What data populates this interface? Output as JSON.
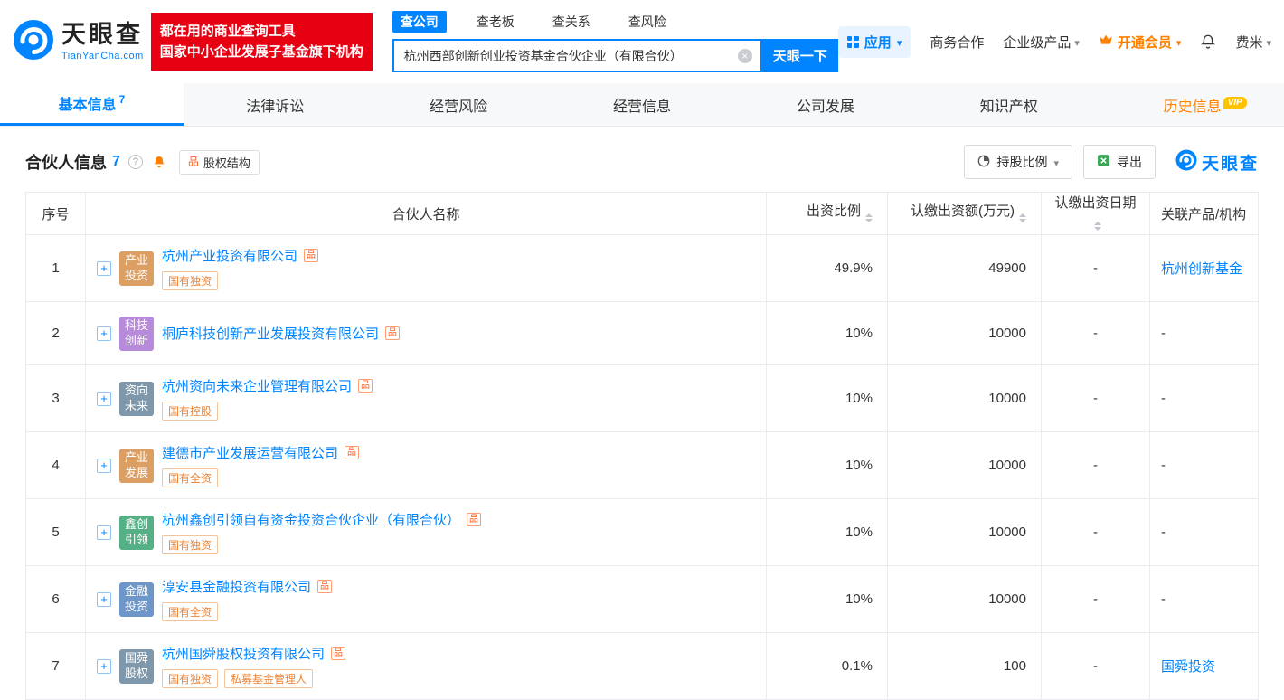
{
  "colors": {
    "brand_blue": "#0084ff",
    "promo_red": "#e60012",
    "vip_orange": "#ff8000",
    "link_blue": "#0084ff"
  },
  "header": {
    "brand": "天眼查",
    "brand_domain": "TianYanCha.com",
    "promo_line1": "都在用的商业查询工具",
    "promo_line2": "国家中小企业发展子基金旗下机构",
    "search_tabs": [
      {
        "label": "查公司",
        "active": true
      },
      {
        "label": "查老板",
        "active": false
      },
      {
        "label": "查关系",
        "active": false
      },
      {
        "label": "查风险",
        "active": false
      }
    ],
    "search_value": "杭州西部创新创业投资基金合伙企业（有限合伙）",
    "search_button": "天眼一下",
    "apps_label": "应用",
    "biz_coop": "商务合作",
    "enterprise_products": "企业级产品",
    "vip_label": "开通会员",
    "user_name": "费米"
  },
  "nav_vip_badge": "VIP",
  "nav_tabs": [
    {
      "label": "基本信息",
      "count": "7",
      "active": true
    },
    {
      "label": "法律诉讼"
    },
    {
      "label": "经营风险"
    },
    {
      "label": "经营信息"
    },
    {
      "label": "公司发展"
    },
    {
      "label": "知识产权"
    },
    {
      "label": "历史信息",
      "vip": true
    }
  ],
  "section": {
    "title": "合伙人信息",
    "count": "7",
    "equity_structure": "股权结构",
    "ratio_filter": "持股比例",
    "export_label": "导出",
    "watermark": "天眼查"
  },
  "table": {
    "headers": {
      "index": "序号",
      "name": "合伙人名称",
      "ratio": "出资比例",
      "amount": "认缴出资额(万元)",
      "date": "认缴出资日期",
      "related": "关联产品/机构"
    },
    "rows": [
      {
        "index": "1",
        "badge_lines": [
          "产业",
          "投资"
        ],
        "badge_color": "#DB9E63",
        "name": "杭州产业投资有限公司",
        "tags": [
          "国有独资"
        ],
        "ratio": "49.9%",
        "amount": "49900",
        "date": "-",
        "related": "杭州创新基金",
        "related_is_link": true
      },
      {
        "index": "2",
        "badge_lines": [
          "科技",
          "创新"
        ],
        "badge_color": "#B78BD9",
        "name": "桐庐科技创新产业发展投资有限公司",
        "tags": [],
        "ratio": "10%",
        "amount": "10000",
        "date": "-",
        "related": "-",
        "related_is_link": false
      },
      {
        "index": "3",
        "badge_lines": [
          "资向",
          "未来"
        ],
        "badge_color": "#7E97AA",
        "name": "杭州资向未来企业管理有限公司",
        "tags": [
          "国有控股"
        ],
        "ratio": "10%",
        "amount": "10000",
        "date": "-",
        "related": "-",
        "related_is_link": false
      },
      {
        "index": "4",
        "badge_lines": [
          "产业",
          "发展"
        ],
        "badge_color": "#DB9E63",
        "name": "建德市产业发展运营有限公司",
        "tags": [
          "国有全资"
        ],
        "ratio": "10%",
        "amount": "10000",
        "date": "-",
        "related": "-",
        "related_is_link": false
      },
      {
        "index": "5",
        "badge_lines": [
          "鑫创",
          "引领"
        ],
        "badge_color": "#55B185",
        "name": "杭州鑫创引领自有资金投资合伙企业（有限合伙）",
        "tags": [
          "国有独资"
        ],
        "ratio": "10%",
        "amount": "10000",
        "date": "-",
        "related": "-",
        "related_is_link": false
      },
      {
        "index": "6",
        "badge_lines": [
          "金融",
          "投资"
        ],
        "badge_color": "#6E96C8",
        "name": "淳安县金融投资有限公司",
        "tags": [
          "国有全资"
        ],
        "ratio": "10%",
        "amount": "10000",
        "date": "-",
        "related": "-",
        "related_is_link": false
      },
      {
        "index": "7",
        "badge_lines": [
          "国舜",
          "股权"
        ],
        "badge_color": "#7E97AA",
        "name": "杭州国舜股权投资有限公司",
        "tags": [
          "国有独资",
          "私募基金管理人"
        ],
        "ratio": "0.1%",
        "amount": "100",
        "date": "-",
        "related": "国舜投资",
        "related_is_link": true
      }
    ]
  }
}
